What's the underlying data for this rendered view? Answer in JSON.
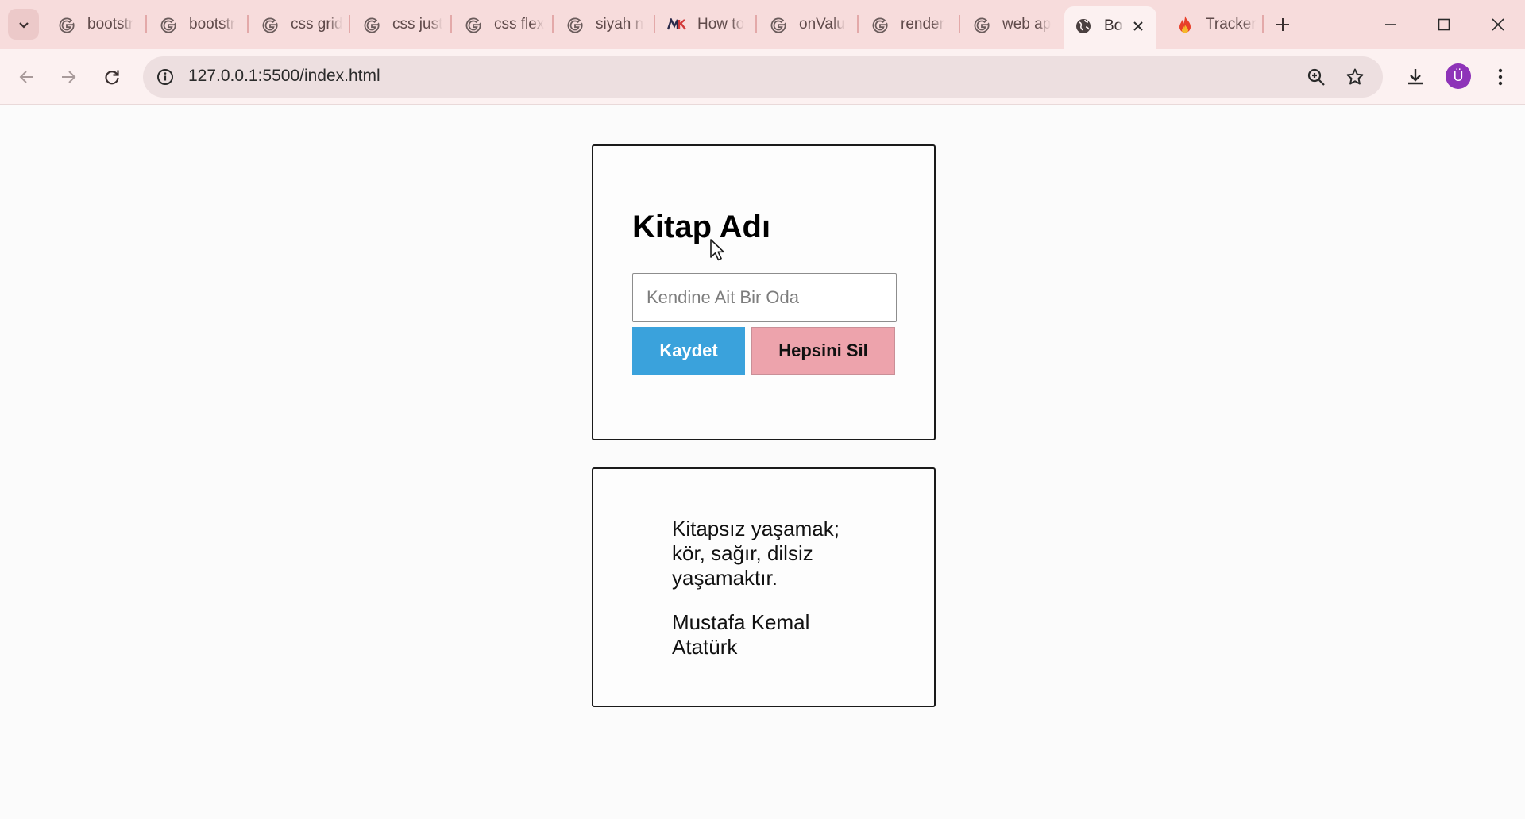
{
  "browser": {
    "tabs": [
      {
        "title": "bootstr",
        "icon": "google-icon"
      },
      {
        "title": "bootstr",
        "icon": "google-icon"
      },
      {
        "title": "css grid",
        "icon": "google-icon"
      },
      {
        "title": "css just",
        "icon": "google-icon"
      },
      {
        "title": "css flex",
        "icon": "google-icon"
      },
      {
        "title": "siyah n",
        "icon": "google-icon"
      },
      {
        "title": "How to",
        "icon": "mk-icon"
      },
      {
        "title": "onValu",
        "icon": "google-icon"
      },
      {
        "title": "render",
        "icon": "google-icon"
      },
      {
        "title": "web ap",
        "icon": "google-icon"
      },
      {
        "title": "Bo",
        "icon": "globe-icon",
        "active": true
      },
      {
        "title": "Tracker",
        "icon": "flame-icon"
      }
    ],
    "url": "127.0.0.1:5500/index.html",
    "profile_initial": "Ü"
  },
  "page": {
    "form": {
      "title": "Kitap Adı",
      "input_placeholder": "Kendine Ait Bir Oda",
      "input_value": "",
      "save_label": "Kaydet",
      "clear_label": "Hepsini Sil"
    },
    "quote": {
      "text": "Kitapsız yaşamak; kör, sağır, dilsiz yaşamaktır.",
      "author": "Mustafa Kemal Atatürk"
    }
  },
  "colors": {
    "tabstrip_bg": "#f7dcdc",
    "toolbar_bg": "#fcf1f1",
    "save_button": "#3aa2dc",
    "clear_button": "#eda3ac"
  }
}
